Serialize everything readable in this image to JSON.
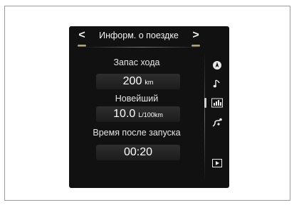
{
  "header": {
    "title": "Информ. о поездке",
    "prev_label": "<",
    "next_label": ">"
  },
  "items": [
    {
      "label": "Запас хода",
      "value": "200",
      "unit": "km"
    },
    {
      "label": "Новейший",
      "value": "10.0",
      "unit": "L/100km"
    },
    {
      "label": "Время после запуска",
      "value": "00:20",
      "unit": ""
    }
  ],
  "sidebar": {
    "icons": [
      "navigation-icon",
      "music-icon",
      "trip-info-icon",
      "route-icon",
      "media-icon"
    ],
    "active": "trip-info-icon"
  },
  "colors": {
    "screen_bg": "#111111",
    "accent": "#d8c9a0"
  }
}
